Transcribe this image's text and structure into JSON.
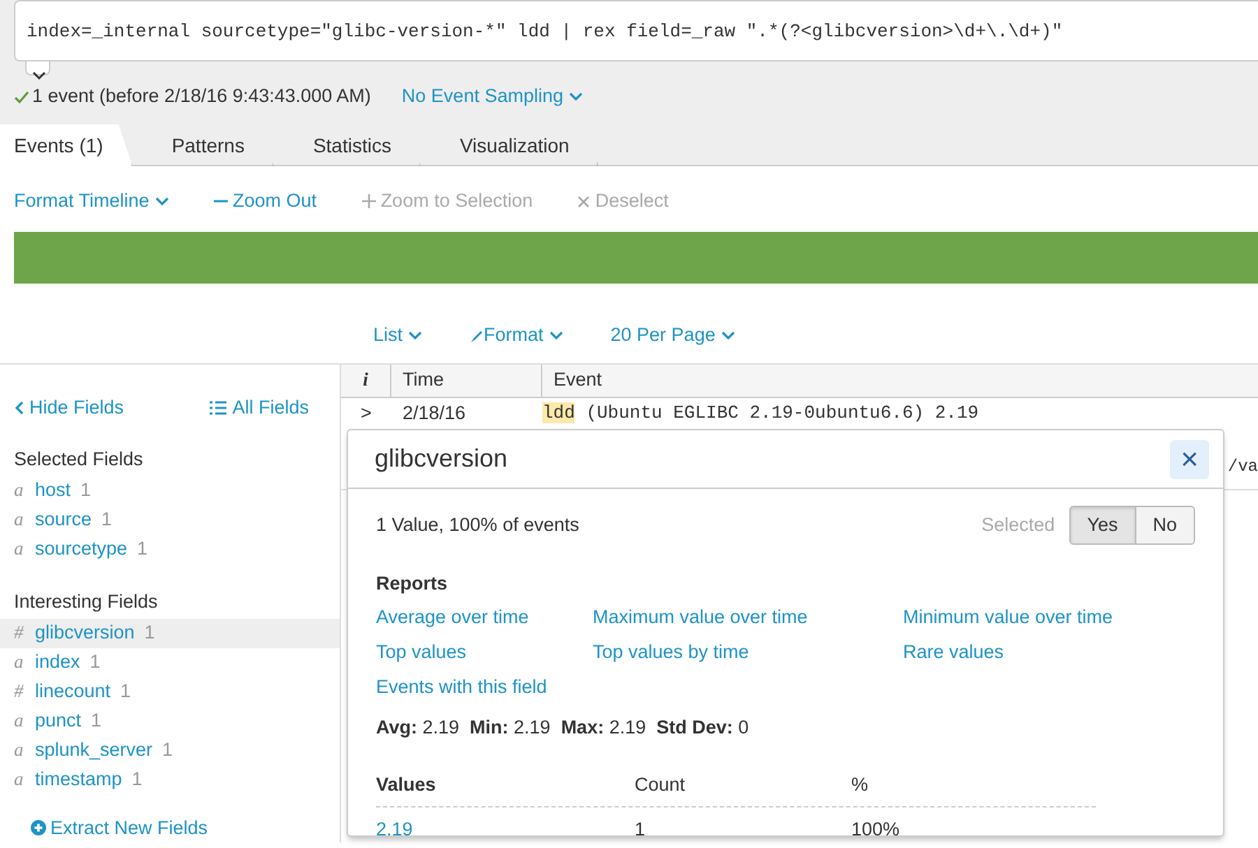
{
  "search": {
    "query": "index=_internal sourcetype=\"glibc-version-*\" ldd | rex field=_raw \".*(?<glibcversion>\\d+\\.\\d+)\""
  },
  "status": {
    "result": "1 event (before 2/18/16 9:43:43.000 AM)",
    "sampling": "No Event Sampling"
  },
  "tabs": [
    {
      "label": "Events (1)",
      "selected": true
    },
    {
      "label": "Patterns",
      "selected": false
    },
    {
      "label": "Statistics",
      "selected": false
    },
    {
      "label": "Visualization",
      "selected": false
    }
  ],
  "timeline_toolbar": [
    {
      "label": "Format Timeline",
      "kind": "dropdown",
      "disabled": false
    },
    {
      "label": "Zoom Out",
      "kind": "minus",
      "disabled": false
    },
    {
      "label": "Zoom to Selection",
      "kind": "plus",
      "disabled": true
    },
    {
      "label": "Deselect",
      "kind": "cross",
      "disabled": true
    }
  ],
  "list_toolbar": [
    {
      "label": "List",
      "kind": "dropdown"
    },
    {
      "label": "Format",
      "kind": "brush"
    },
    {
      "label": "20 Per Page",
      "kind": "dropdown"
    }
  ],
  "sidebar": {
    "hide_fields": "Hide Fields",
    "all_fields": "All Fields",
    "sections": [
      {
        "title": "Selected Fields",
        "fields": [
          {
            "type": "a",
            "name": "host",
            "count": "1",
            "selected": false
          },
          {
            "type": "a",
            "name": "source",
            "count": "1",
            "selected": false
          },
          {
            "type": "a",
            "name": "sourcetype",
            "count": "1",
            "selected": false
          }
        ]
      },
      {
        "title": "Interesting Fields",
        "fields": [
          {
            "type": "#",
            "name": "glibcversion",
            "count": "1",
            "selected": true
          },
          {
            "type": "a",
            "name": "index",
            "count": "1",
            "selected": false
          },
          {
            "type": "#",
            "name": "linecount",
            "count": "1",
            "selected": false
          },
          {
            "type": "a",
            "name": "punct",
            "count": "1",
            "selected": false
          },
          {
            "type": "a",
            "name": "splunk_server",
            "count": "1",
            "selected": false
          },
          {
            "type": "a",
            "name": "timestamp",
            "count": "1",
            "selected": false
          }
        ]
      }
    ],
    "extract": "Extract New Fields"
  },
  "table": {
    "columns": [
      "i",
      "Time",
      "Event"
    ],
    "rows": [
      {
        "expander": ">",
        "time": "2/18/16",
        "highlight": "ldd",
        "event": " (Ubuntu EGLIBC 2.19-0ubuntu6.6) 2.19",
        "continuation": "/va"
      }
    ]
  },
  "popup": {
    "title": "glibcversion",
    "close": "×",
    "summary": "1 Value, 100% of events",
    "selected_label": "Selected",
    "selected_options": [
      {
        "label": "Yes",
        "selected": true
      },
      {
        "label": "No",
        "selected": false
      }
    ],
    "reports_title": "Reports",
    "reports": [
      "Average over time",
      "Maximum value over time",
      "Minimum value over time",
      "Top values",
      "Top values by time",
      "Rare values",
      "Events with this field"
    ],
    "stats": "**Avg:** 2.19  **Min:** 2.19  **Max:** 2.19  **Std Dev:** 0",
    "values_columns": [
      "Values",
      "Count",
      "%"
    ],
    "values_rows": [
      [
        "2.19",
        "1",
        "100%"
      ]
    ]
  }
}
